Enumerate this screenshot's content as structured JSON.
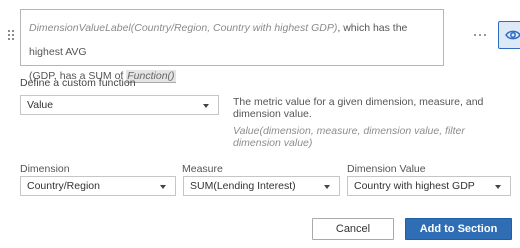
{
  "expression": {
    "dimension_label_call": "DimensionValueLabel(Country/Region, Country with highest GDP)",
    "text_part_1": ", which has the highest AVG",
    "text_part_2": "(GDP, has a SUM of ",
    "function_chip": "Function()",
    "text_part_3": ""
  },
  "toolbar": {
    "more_icon": "ellipsis-horizontal-icon",
    "preview_icon": "eye-icon",
    "accent_color": "#2d6cc0"
  },
  "custom_function": {
    "section_label": "Define a custom function",
    "function_select_value": "Value",
    "description": "The metric value for a given dimension, measure, and dimension value.",
    "syntax": "Value(dimension, measure, dimension value, filter dimension value)"
  },
  "fields": {
    "dimension": {
      "label": "Dimension",
      "value": "Country/Region"
    },
    "measure": {
      "label": "Measure",
      "value": "SUM(Lending Interest)"
    },
    "dimension_value": {
      "label": "Dimension Value",
      "value": "Country with highest GDP"
    }
  },
  "actions": {
    "cancel_label": "Cancel",
    "add_label": "Add to Section",
    "primary_color": "#2f6db5"
  }
}
